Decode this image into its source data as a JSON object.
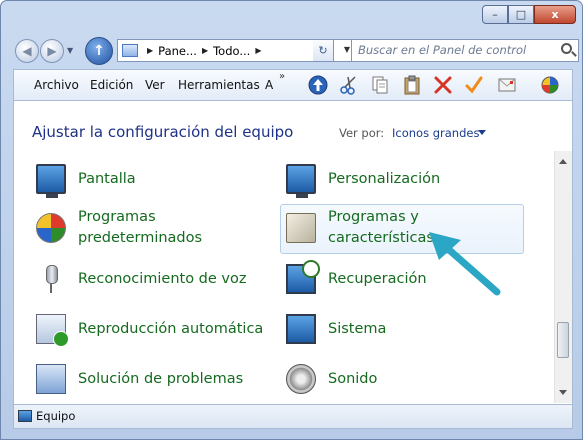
{
  "window": {
    "caption_min": "–",
    "caption_max": "□",
    "caption_close": "x"
  },
  "nav": {
    "back": "◀",
    "forward": "▶",
    "up": "↑",
    "breadcrumb": [
      "Pane...",
      "Todo..."
    ],
    "refresh": "↻",
    "search_placeholder": "Buscar en el Panel de control"
  },
  "toolbar": {
    "menus": [
      "Archivo",
      "Edición",
      "Ver",
      "Herramientas",
      "A"
    ],
    "more": "»",
    "icons": [
      "up-arrow-icon",
      "scissors-icon",
      "copy-icon",
      "paste-icon",
      "delete-icon",
      "check-icon",
      "email-icon",
      "color-wheel-icon"
    ]
  },
  "content": {
    "heading": "Ajustar la configuración del equipo",
    "view_by_label": "Ver por:",
    "view_by_value": "Iconos grandes",
    "items_left": [
      {
        "label": "Pantalla",
        "icon": "monitor-icon"
      },
      {
        "label1": "Programas",
        "label2": "predeterminados",
        "icon": "default-programs-icon"
      },
      {
        "label": "Reconocimiento de voz",
        "icon": "microphone-icon"
      },
      {
        "label": "Reproducción automática",
        "icon": "autoplay-icon"
      },
      {
        "label": "Solución de problemas",
        "icon": "troubleshooting-icon"
      }
    ],
    "items_right": [
      {
        "label": "Personalización",
        "icon": "personalization-icon"
      },
      {
        "label1": "Programas y",
        "label2": "características",
        "icon": "programs-features-icon"
      },
      {
        "label": "Recuperación",
        "icon": "recovery-icon"
      },
      {
        "label": "Sistema",
        "icon": "system-icon"
      },
      {
        "label": "Sonido",
        "icon": "speaker-icon"
      }
    ],
    "highlight_color": "#29a3c8"
  },
  "status": {
    "text": "Equipo"
  }
}
